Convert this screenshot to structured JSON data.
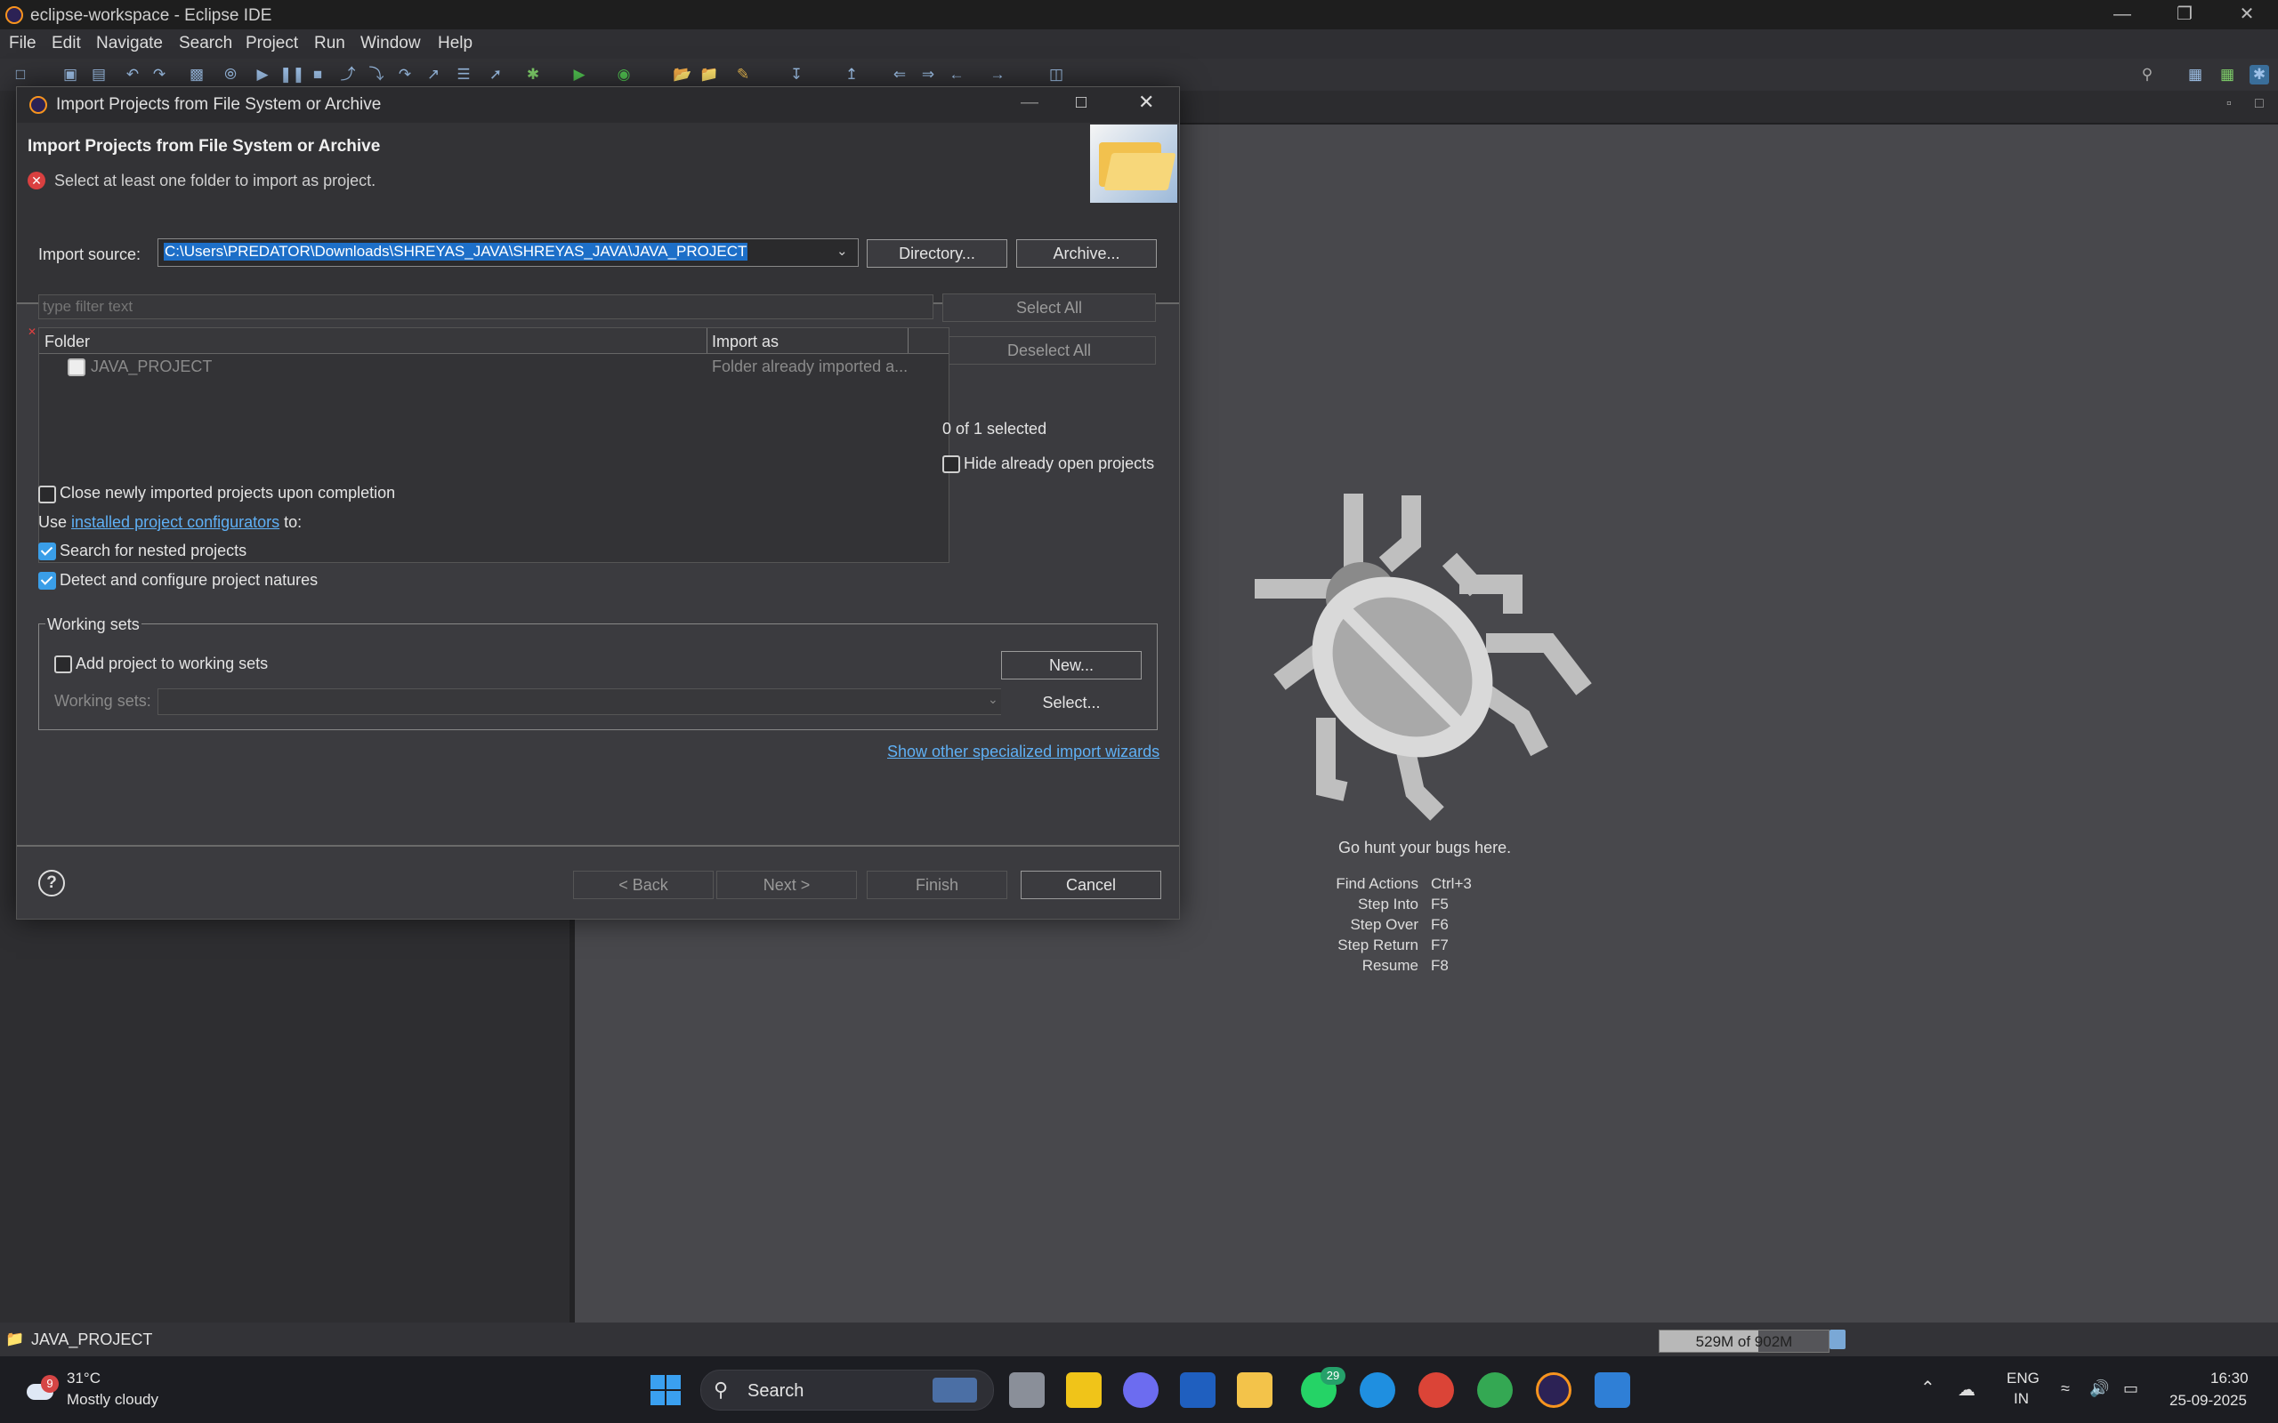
{
  "window": {
    "title": "eclipse-workspace - Eclipse IDE"
  },
  "menu": [
    "File",
    "Edit",
    "Navigate",
    "Search",
    "Project",
    "Run",
    "Window",
    "Help"
  ],
  "dialog": {
    "title": "Import Projects from File System or Archive",
    "header_title": "Import Projects from File System or Archive",
    "error_message": "Select at least one folder to import as project.",
    "import_source_label": "Import source:",
    "import_source_value": "C:\\Users\\PREDATOR\\Downloads\\SHREYAS_JAVA\\SHREYAS_JAVA\\JAVA_PROJECT",
    "directory_button": "Directory...",
    "archive_button": "Archive...",
    "filter_placeholder": "type filter text",
    "select_all": "Select All",
    "deselect_all": "Deselect All",
    "table": {
      "columns": [
        "Folder",
        "Import as"
      ],
      "rows": [
        {
          "folder": "JAVA_PROJECT",
          "import_as": "Folder already imported a..."
        }
      ]
    },
    "selected_count": "0 of 1 selected",
    "hide_open_projects": "Hide already open projects",
    "close_newly_imported": "Close newly imported projects upon completion",
    "use_prefix": "Use",
    "configurators_link": "installed project configurators",
    "use_suffix": "to:",
    "search_nested": "Search for nested projects",
    "detect_natures": "Detect and configure project natures",
    "working_sets": {
      "group_label": "Working sets",
      "add_label": "Add project to working sets",
      "new_button": "New...",
      "working_sets_label": "Working sets:",
      "select_button": "Select..."
    },
    "other_wizards_link": "Show other specialized import wizards",
    "buttons": {
      "back": "< Back",
      "next": "Next >",
      "finish": "Finish",
      "cancel": "Cancel"
    }
  },
  "welcome": {
    "tagline": "Go hunt your bugs here.",
    "shortcuts": [
      {
        "action": "Find Actions",
        "key": "Ctrl+3"
      },
      {
        "action": "Step Into",
        "key": "F5"
      },
      {
        "action": "Step Over",
        "key": "F6"
      },
      {
        "action": "Step Return",
        "key": "F7"
      },
      {
        "action": "Resume",
        "key": "F8"
      }
    ]
  },
  "status": {
    "project": "JAVA_PROJECT",
    "heap": "529M of 902M",
    "heap_fraction": 0.586
  },
  "taskbar": {
    "temp": "31°C",
    "weather": "Mostly cloudy",
    "weather_badge": "9",
    "search": "Search",
    "whatsapp_badge": "29",
    "lang_line1": "ENG",
    "lang_line2": "IN",
    "time": "16:30",
    "date": "25-09-2025"
  }
}
